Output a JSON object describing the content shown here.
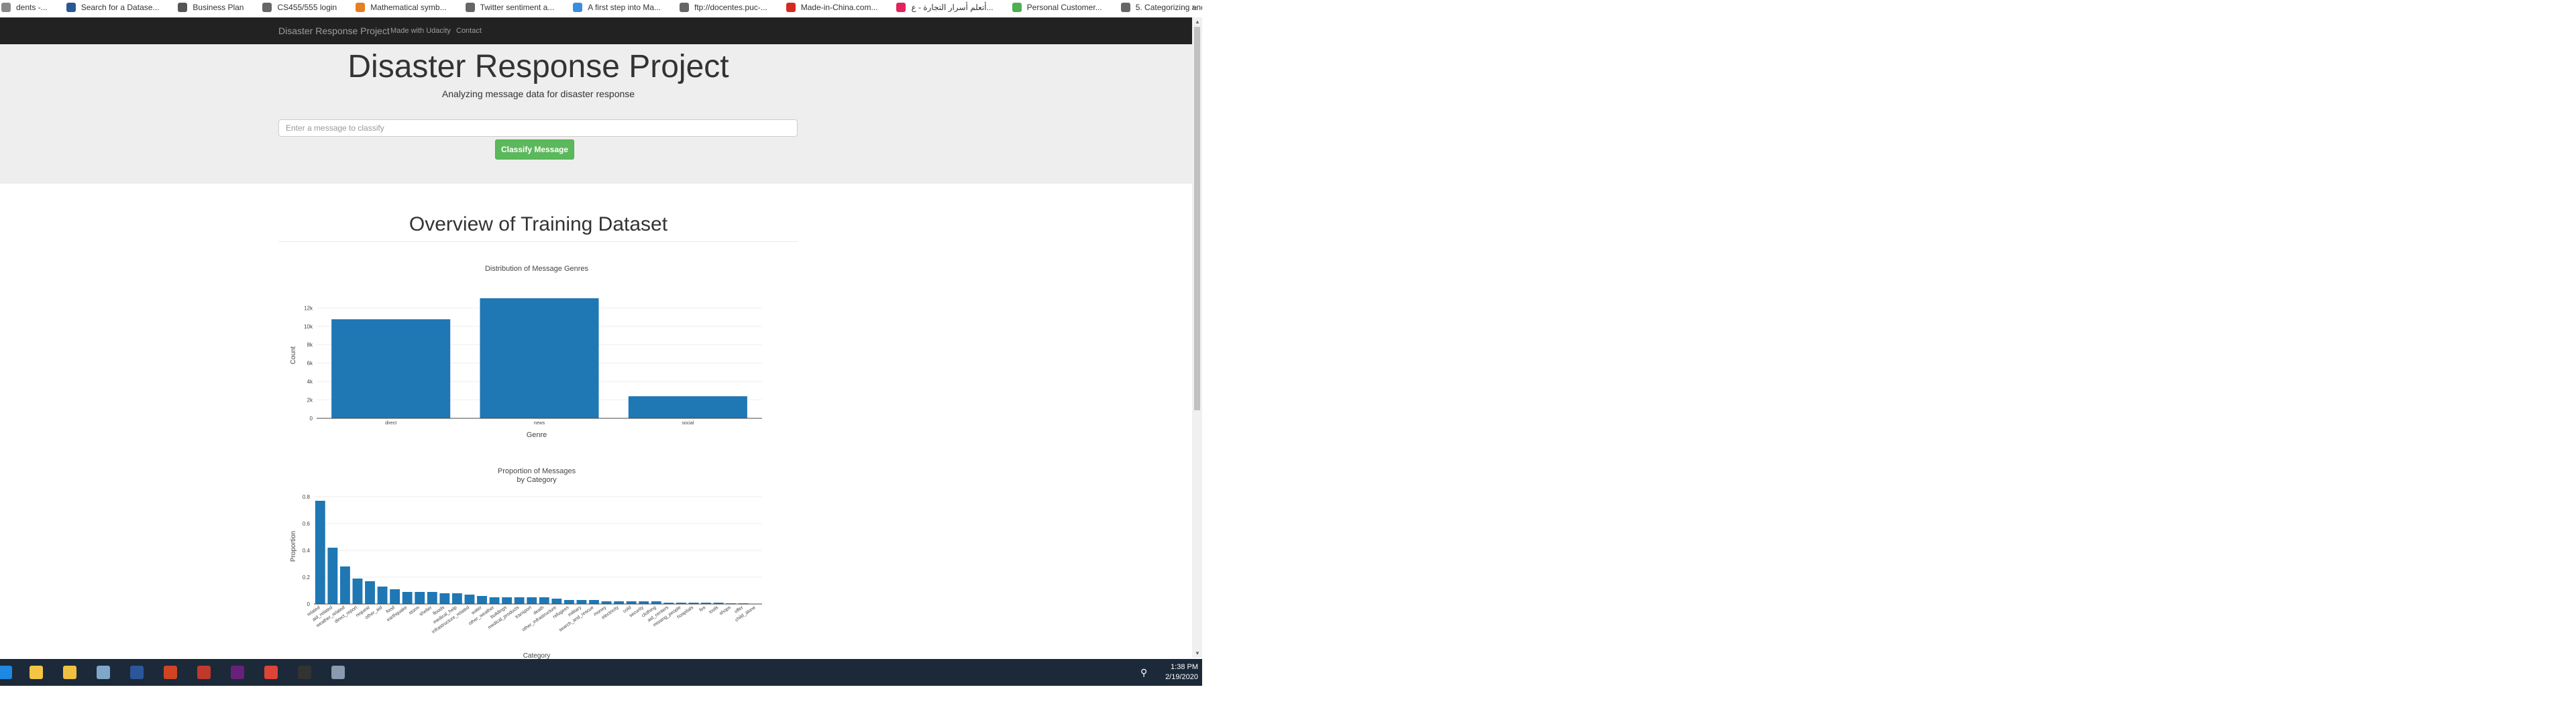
{
  "bookmarks": [
    {
      "label": "dents -...",
      "icon": "page-icon",
      "color": "#888888"
    },
    {
      "label": "Search for a Datase...",
      "icon": "d-logo-icon",
      "color": "#2b5797"
    },
    {
      "label": "Business Plan",
      "icon": "car-icon",
      "color": "#555555"
    },
    {
      "label": "CS455/555 login",
      "icon": "globe-icon",
      "color": "#666666"
    },
    {
      "label": "Mathematical symb...",
      "icon": "r-logo-icon",
      "color": "#e67e22"
    },
    {
      "label": "Twitter sentiment a...",
      "icon": "globe-icon",
      "color": "#666666"
    },
    {
      "label": "A first step into Ma...",
      "icon": "gear-icon",
      "color": "#3a8dde"
    },
    {
      "label": "ftp://docentes.puc-...",
      "icon": "globe-icon",
      "color": "#666666"
    },
    {
      "label": "Made-in-China.com...",
      "icon": "m-logo-icon",
      "color": "#d52b1e"
    },
    {
      "label": "أتعلم أسرار التجارة - ع...",
      "icon": "heart-icon",
      "color": "#e0245e"
    },
    {
      "label": "Personal Customer...",
      "icon": "check-icon",
      "color": "#4caf50"
    },
    {
      "label": "5. Categorizing and...",
      "icon": "globe-icon",
      "color": "#666666"
    }
  ],
  "bookmarks_more": "»",
  "navbar": {
    "brand": "Disaster Response Project",
    "links": [
      "Made with Udacity",
      "Contact"
    ]
  },
  "jumbotron": {
    "title": "Disaster Response Project",
    "subtitle": "Analyzing message data for disaster response",
    "input_placeholder": "Enter a message to classify",
    "button_label": "Classify Message"
  },
  "overview_title": "Overview of Training Dataset",
  "charts": {
    "bar_color": "#1f77b4",
    "genres": {
      "title": "Distribution of Message Genres",
      "xlabel": "Genre",
      "ylabel": "Count"
    },
    "categories": {
      "title_line1": "Proportion of Messages",
      "title_line2": "by Category",
      "xlabel": "Category",
      "ylabel": "Proportion"
    }
  },
  "chart_data": [
    {
      "type": "bar",
      "title": "Distribution of Message Genres",
      "xlabel": "Genre",
      "ylabel": "Count",
      "categories": [
        "direct",
        "news",
        "social"
      ],
      "values": [
        10766,
        13054,
        2396
      ],
      "ylim": [
        0,
        13700
      ],
      "yticks": [
        0,
        2000,
        4000,
        6000,
        8000,
        10000,
        12000
      ],
      "ytick_labels": [
        "0",
        "2k",
        "4k",
        "6k",
        "8k",
        "10k",
        "12k"
      ],
      "grid": true,
      "legend": "none"
    },
    {
      "type": "bar",
      "title": "Proportion of Messages by Category",
      "xlabel": "Category",
      "ylabel": "Proportion",
      "categories": [
        "related",
        "aid_related",
        "weather_related",
        "direct_report",
        "request",
        "other_aid",
        "food",
        "earthquake",
        "storm",
        "shelter",
        "floods",
        "medical_help",
        "infrastructure_related",
        "water",
        "other_weather",
        "buildings",
        "medical_products",
        "transport",
        "death",
        "other_infrastructure",
        "refugees",
        "military",
        "search_and_rescue",
        "money",
        "electricity",
        "cold",
        "security",
        "clothing",
        "aid_centers",
        "missing_people",
        "hospitals",
        "fire",
        "tools",
        "shops",
        "offer",
        "child_alone"
      ],
      "values": [
        0.77,
        0.42,
        0.28,
        0.19,
        0.17,
        0.13,
        0.11,
        0.09,
        0.09,
        0.09,
        0.08,
        0.08,
        0.07,
        0.06,
        0.05,
        0.05,
        0.05,
        0.05,
        0.05,
        0.04,
        0.03,
        0.03,
        0.03,
        0.02,
        0.02,
        0.02,
        0.02,
        0.02,
        0.01,
        0.01,
        0.01,
        0.01,
        0.01,
        0.005,
        0.005,
        0.0
      ],
      "ylim": [
        0,
        0.8
      ],
      "yticks": [
        0,
        0.2,
        0.4,
        0.6,
        0.8
      ],
      "ytick_labels": [
        "0",
        "0.2",
        "0.4",
        "0.6",
        "0.8"
      ],
      "grid": true,
      "legend": "none"
    }
  ],
  "taskbar": {
    "apps": [
      {
        "name": "edge-icon",
        "color": "#1e88e5"
      },
      {
        "name": "file-explorer-icon",
        "color": "#f4c542"
      },
      {
        "name": "store-icon",
        "color": "#f0c040"
      },
      {
        "name": "calculator-icon",
        "color": "#7fa7c9"
      },
      {
        "name": "word-icon",
        "color": "#2b579a"
      },
      {
        "name": "powerpoint-icon",
        "color": "#d04423"
      },
      {
        "name": "calendar-icon",
        "color": "#c0392b"
      },
      {
        "name": "visual-studio-icon",
        "color": "#68217a"
      },
      {
        "name": "chrome-icon",
        "color": "#db4437"
      },
      {
        "name": "terminal-icon",
        "color": "#333333"
      },
      {
        "name": "snipping-tool-icon",
        "color": "#8a9bb0"
      }
    ],
    "time": "1:38 PM",
    "date": "2/19/2020"
  }
}
